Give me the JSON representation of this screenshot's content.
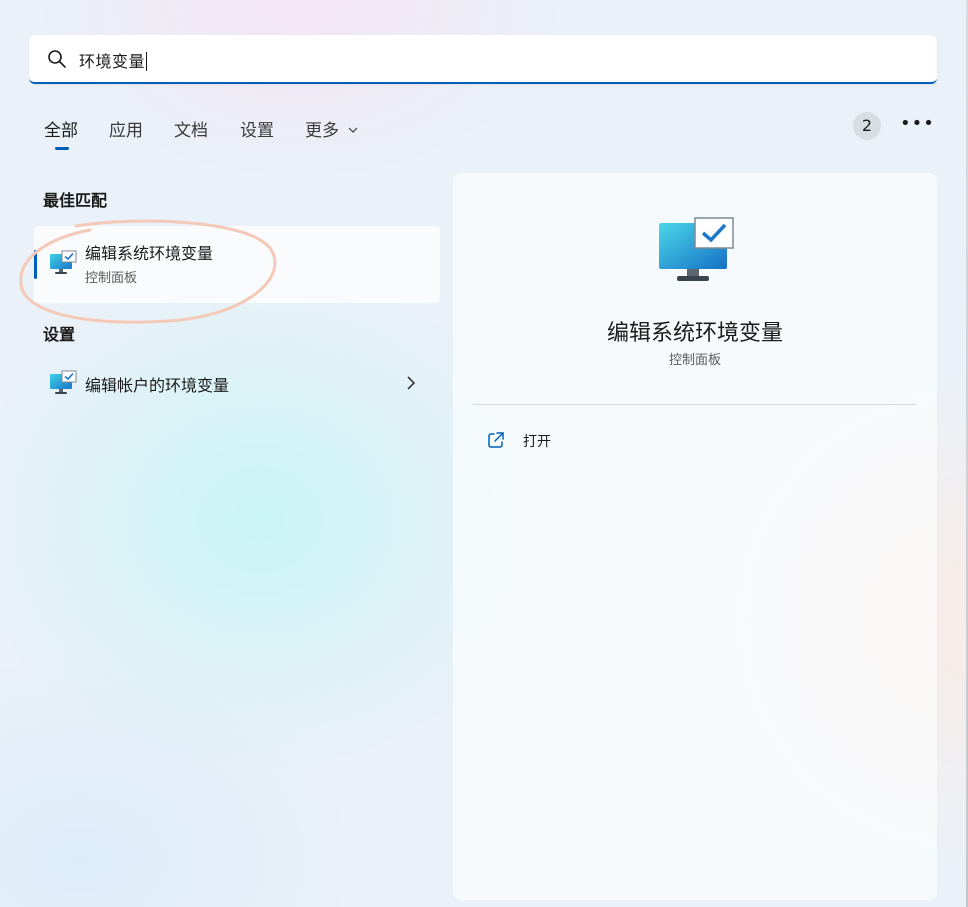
{
  "search": {
    "query": "环境变量"
  },
  "tabs": [
    {
      "label": "全部",
      "active": true
    },
    {
      "label": "应用",
      "active": false
    },
    {
      "label": "文档",
      "active": false
    },
    {
      "label": "设置",
      "active": false
    },
    {
      "label": "更多",
      "active": false
    }
  ],
  "header": {
    "count_badge": "2",
    "more_label": "•••"
  },
  "best_match": {
    "heading": "最佳匹配",
    "title": "编辑系统环境变量",
    "subtitle": "控制面板",
    "icon": "system-properties-monitor-icon"
  },
  "settings": {
    "heading": "设置",
    "items": [
      {
        "title": "编辑帐户的环境变量",
        "icon": "system-properties-monitor-icon"
      }
    ]
  },
  "detail": {
    "title": "编辑系统环境变量",
    "subtitle": "控制面板",
    "icon": "system-properties-monitor-icon",
    "actions": [
      {
        "label": "打开",
        "icon": "open-external-icon"
      }
    ]
  },
  "colors": {
    "accent": "#005fb8",
    "annotation": "#f4c9b8"
  }
}
